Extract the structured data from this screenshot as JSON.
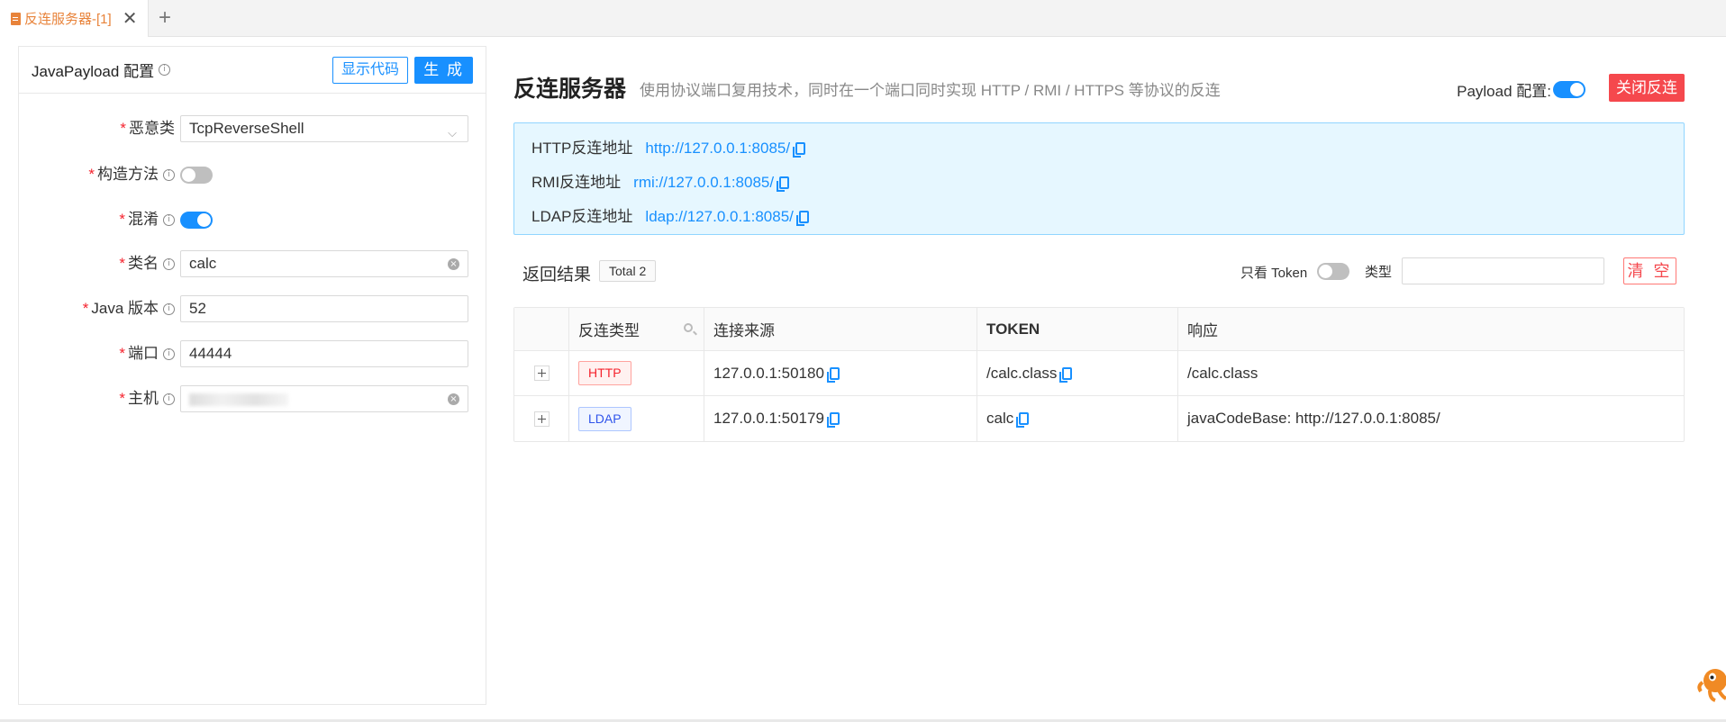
{
  "tab": {
    "label": "反连服务器-[1]",
    "close": "✕",
    "add": "+"
  },
  "left": {
    "title": "JavaPayload 配置",
    "show_code_label": "显示代码",
    "generate_label": "生 成",
    "fields": {
      "malicious_class": {
        "label": "恶意类",
        "value": "TcpReverseShell"
      },
      "construct_method": {
        "label": "构造方法",
        "enabled": false
      },
      "obfuscate": {
        "label": "混淆",
        "enabled": true
      },
      "class_name": {
        "label": "类名",
        "value": "calc"
      },
      "java_version": {
        "label": "Java 版本",
        "value": "52"
      },
      "port": {
        "label": "端口",
        "value": "44444"
      },
      "host": {
        "label": "主机",
        "value": ""
      }
    }
  },
  "right": {
    "title": "反连服务器",
    "description": "使用协议端口复用技术，同时在一个端口同时实现 HTTP / RMI / HTTPS 等协议的反连",
    "payload_config_label": "Payload 配置:",
    "payload_config_enabled": true,
    "close_button_label": "关闭反连",
    "addresses": [
      {
        "label": "HTTP反连地址",
        "url": "http://127.0.0.1:8085/"
      },
      {
        "label": "RMI反连地址",
        "url": "rmi://127.0.0.1:8085/"
      },
      {
        "label": "LDAP反连地址",
        "url": "ldap://127.0.0.1:8085/"
      }
    ],
    "results_title": "返回结果",
    "total_label": "Total 2",
    "token_only_label": "只看 Token",
    "token_only_enabled": false,
    "type_label": "类型",
    "type_value": "",
    "clear_label": "清 空",
    "table": {
      "headers": [
        "反连类型",
        "连接来源",
        "TOKEN",
        "响应"
      ],
      "rows": [
        {
          "type": "HTTP",
          "source": "127.0.0.1:50180",
          "token": "/calc.class",
          "response": "/calc.class"
        },
        {
          "type": "LDAP",
          "source": "127.0.0.1:50179",
          "token": "calc",
          "response": "javaCodeBase: http://127.0.0.1:8085/"
        }
      ]
    }
  },
  "colors": {
    "primary": "#1890ff",
    "danger": "#f5484d",
    "tab_accent": "#e8833a",
    "info_bg": "#e6f7ff"
  }
}
